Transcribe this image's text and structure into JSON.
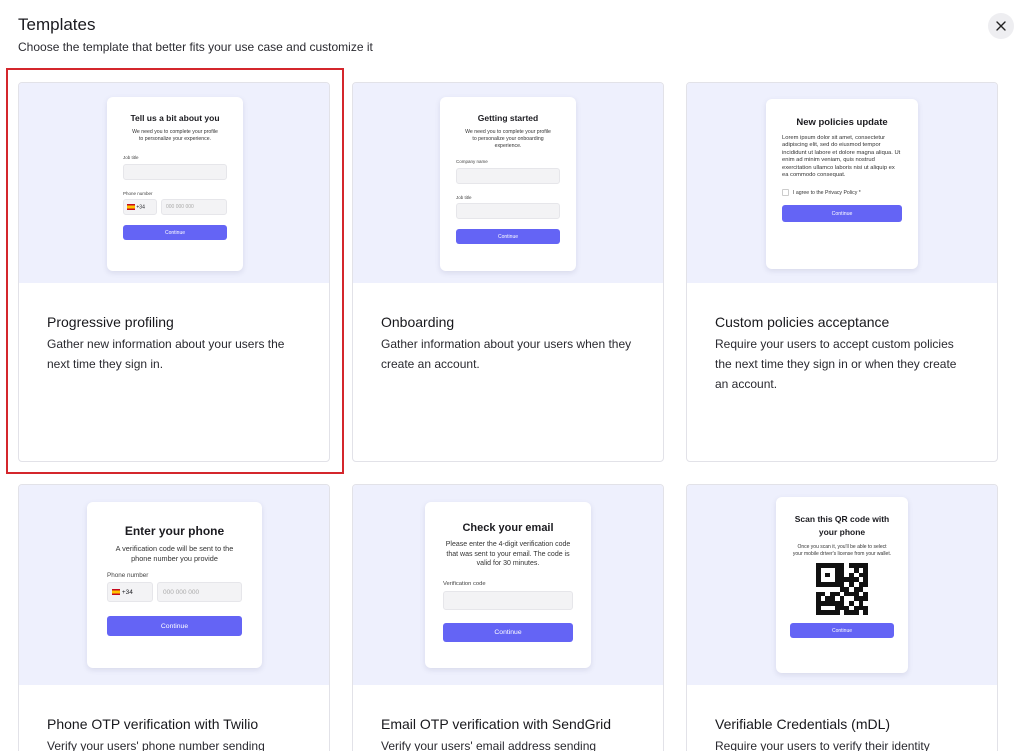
{
  "header": {
    "title": "Templates",
    "subtitle": "Choose the template that better fits your use case and customize it"
  },
  "cards": [
    {
      "title": "Progressive profiling",
      "description": "Gather new information about your users the next time they sign in.",
      "preview": {
        "heading": "Tell us a bit about you",
        "text": "We need you to complete your profile to personalize your experience.",
        "field1_label": "Job title",
        "field2_label": "Phone number",
        "country_code": "+34",
        "phone_placeholder": "000 000 000",
        "button": "Continue"
      }
    },
    {
      "title": "Onboarding",
      "description": "Gather information about your users when they create an account.",
      "preview": {
        "heading": "Getting started",
        "text": "We need you to complete your profile to personalize your onboarding experience.",
        "field1_label": "Company name",
        "field2_label": "Job title",
        "button": "Continue"
      }
    },
    {
      "title": "Custom policies acceptance",
      "description": "Require your users to accept custom policies the next time they sign in or when they create an account.",
      "preview": {
        "heading": "New policies update",
        "text": "Lorem ipsum dolor sit amet, consectetur adipiscing elit, sed do eiusmod tempor incididunt ut labore et dolore magna aliqua. Ut enim ad minim veniam, quis nostrud exercitation ullamco laboris nisi ut aliquip ex ea commodo consequat.",
        "checkbox_label": "I agree to the Privacy Policy *",
        "button": "Continue"
      }
    },
    {
      "title": "Phone OTP verification with Twilio",
      "description": "Verify your users' phone number sending",
      "preview": {
        "heading": "Enter your phone",
        "text": "A verification code will be sent to the phone number you provide",
        "field_label": "Phone number",
        "country_code": "+34",
        "phone_placeholder": "000 000 000",
        "button": "Continue"
      }
    },
    {
      "title": "Email OTP verification with SendGrid",
      "description": "Verify your users' email address sending",
      "preview": {
        "heading": "Check your email",
        "text": "Please enter the 4-digit verification code that was sent to your email. The code is valid for 30 minutes.",
        "field_label": "Verification code",
        "button": "Continue"
      }
    },
    {
      "title": "Verifiable Credentials (mDL)",
      "description": "Require your users to verify their identity",
      "preview": {
        "heading": "Scan this QR code with your phone",
        "text": "Once you scan it, you'll be able to select your mobile driver's license from your wallet.",
        "button": "Continue"
      }
    }
  ],
  "colors": {
    "accent": "#6464f5",
    "preview_bg": "#eef0fd",
    "selection": "#d4262c"
  }
}
